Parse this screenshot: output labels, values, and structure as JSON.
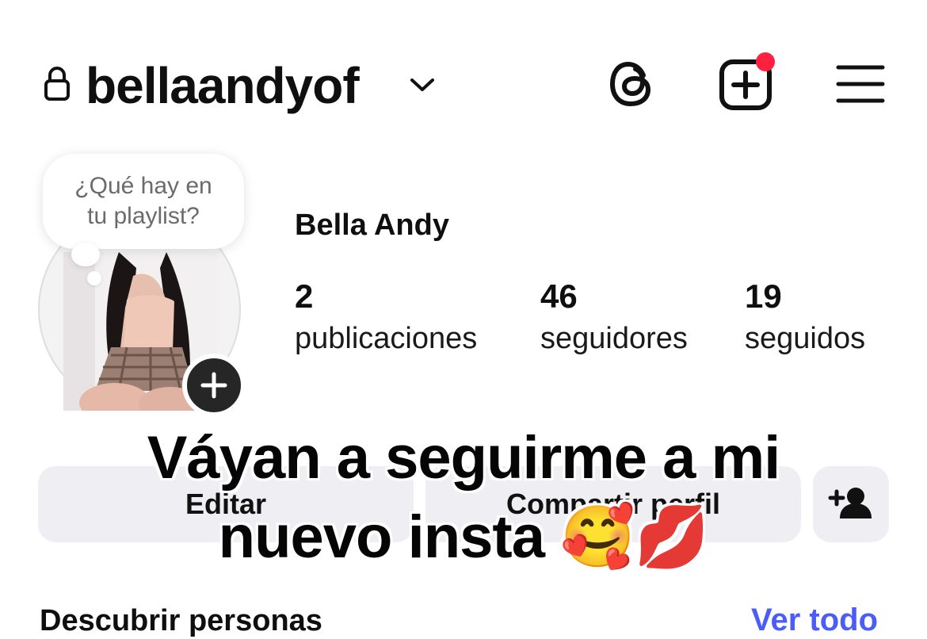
{
  "header": {
    "username": "bellaandyof",
    "icons": [
      "lock-icon",
      "chevron-down-icon",
      "threads-icon",
      "new-post-icon",
      "menu-icon"
    ],
    "notification_color": "#ff1f3f"
  },
  "profile": {
    "note_line1": "¿Qué hay en",
    "note_line2": "tu playlist?",
    "full_name": "Bella Andy",
    "stats": [
      {
        "value": "2",
        "label": "publicaciones"
      },
      {
        "value": "46",
        "label": "seguidores"
      },
      {
        "value": "19",
        "label": "seguidos"
      }
    ]
  },
  "actions": {
    "edit_label": "Editar",
    "share_label": "Compartir perfil"
  },
  "overlay": {
    "line1": "Váyan a seguirme a mi",
    "line2": "nuevo insta 🥰💋"
  },
  "discover": {
    "title": "Descubrir personas",
    "see_all": "Ver todo",
    "link_color": "#4a5df9"
  }
}
